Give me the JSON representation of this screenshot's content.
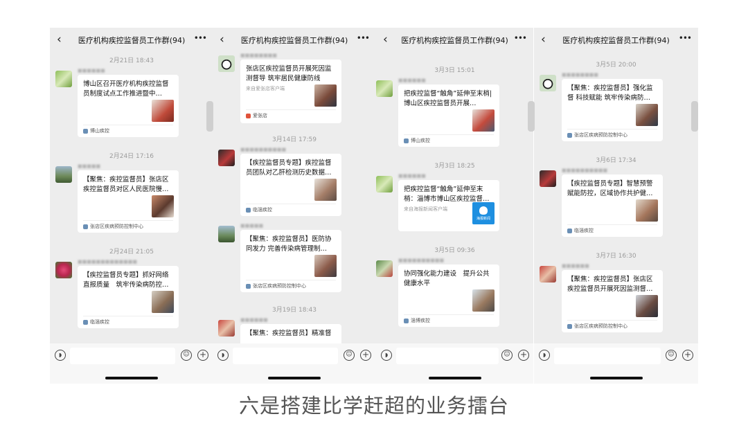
{
  "colors": {
    "screen_bg": "#ededed",
    "card_bg": "#ffffff",
    "timestamp": "#9a9a9a",
    "caption": "#555555"
  },
  "caption": "六是搭建比学赶超的业务擂台",
  "screens": [
    {
      "title": "医疗机构疾控监督员工作群(94)",
      "messages": [
        {
          "time": "2月21日 18:43",
          "title": "博山区召开医疗机构疾控监督员制度试点工作推进暨中…",
          "footer": "博山疾控"
        },
        {
          "time": "2月24日 17:16",
          "title": "【聚焦：疾控监督员】张店区疾控监督员对区人民医院慢…",
          "footer": "张店区疾病预防控制中心"
        },
        {
          "time": "2月24日 21:05",
          "title": "【疾控监督员专题】抓好网络直报质量　筑牢传染病防控…",
          "footer": "临淄疾控"
        }
      ]
    },
    {
      "title": "医疗机构疾控监督员工作群(94)",
      "messages": [
        {
          "time": "",
          "title": "张店区疾控监督员开展死因监测督导 筑牢居民健康防线",
          "source": "来自爱张店客户端",
          "footer": "爱张店"
        },
        {
          "time": "3月14日 17:59",
          "title": "【疾控监督员专题】疾控监督员团队对乙肝检测历史数据…",
          "footer": "临淄疾控"
        },
        {
          "time": "",
          "title": "【聚焦：疾控监督员】医防协同发力 完善传染病管理制…",
          "footer": "张店区疾病预防控制中心"
        },
        {
          "time": "3月19日 18:43",
          "title": "【聚焦：疾控监督员】精准督",
          "footer": ""
        }
      ]
    },
    {
      "title": "医疗机构疾控监督员工作群(94)",
      "messages": [
        {
          "time": "3月3日 15:01",
          "title": "把疾控监督“触角”延伸至末梢|博山区疾控监督员开展…",
          "footer": "博山疾控"
        },
        {
          "time": "3月3日 18:25",
          "title": "把疾控监督“触角”延伸至末梢：淄博市博山区疾控监督…",
          "source": "来自海报新闻客户端",
          "thumb_label": "海报新闻"
        },
        {
          "time": "3月5日 09:36",
          "title": "协同强化能力建设　提升公共健康水平",
          "footer": "淄博疾控"
        }
      ]
    },
    {
      "title": "医疗机构疾控监督员工作群(94)",
      "messages": [
        {
          "time": "3月5日 20:00",
          "title": "【聚焦：疾控监督员】强化监督 科技赋能 筑牢传染病防…",
          "footer": "张店区疾病预防控制中心"
        },
        {
          "time": "3月6日 17:34",
          "title": "【疾控监督员专题】智慧预警赋能防控，区域协作共护健…",
          "footer": "临淄疾控"
        },
        {
          "time": "3月7日 16:30",
          "title": "【聚焦：疾控监督员】张店区疾控监督员开展死因监测督…",
          "footer": "张店区疾病预防控制中心"
        }
      ]
    }
  ]
}
